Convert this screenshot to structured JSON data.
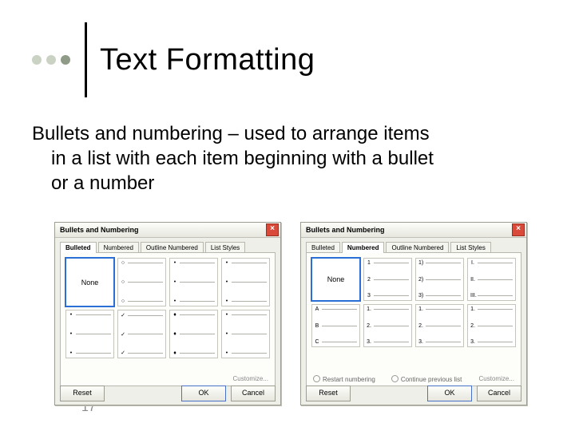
{
  "slide": {
    "title": "Text Formatting",
    "body_line1": "Bullets and numbering – used to arrange items",
    "body_line2": "in a list with each item beginning with a bullet",
    "body_line3": "or a number",
    "page_number": "17"
  },
  "dialog_shared": {
    "title": "Bullets and Numbering",
    "tabs": {
      "bulleted": "Bulleted",
      "numbered": "Numbered",
      "outline": "Outline Numbered",
      "list_styles": "List Styles"
    },
    "none_tile": "None",
    "customize": "Customize...",
    "reset": "Reset",
    "ok": "OK",
    "cancel": "Cancel"
  },
  "bulleted_dialog": {
    "active_tab": "Bulleted",
    "tiles": [
      {
        "type": "none"
      },
      {
        "marks": [
          "○",
          "○",
          "○"
        ]
      },
      {
        "marks": [
          "•",
          "•",
          "•"
        ]
      },
      {
        "marks": [
          "•",
          "•",
          "•"
        ]
      },
      {
        "marks": [
          "•",
          "•",
          "•"
        ]
      },
      {
        "marks": [
          "✓",
          "✓",
          "✓"
        ]
      },
      {
        "marks": [
          "♦",
          "♦",
          "♦"
        ]
      },
      {
        "marks": [
          "•",
          "•",
          "•"
        ]
      }
    ]
  },
  "numbered_dialog": {
    "active_tab": "Numbered",
    "radios": {
      "restart": "Restart numbering",
      "continue": "Continue previous list"
    },
    "tiles": [
      {
        "type": "none"
      },
      {
        "marks": [
          "1",
          "2",
          "3"
        ]
      },
      {
        "marks": [
          "1)",
          "2)",
          "3)"
        ]
      },
      {
        "marks": [
          "I.",
          "II.",
          "III."
        ]
      },
      {
        "marks": [
          "A",
          "B",
          "C"
        ]
      },
      {
        "marks": [
          "1.",
          "2.",
          "3."
        ]
      },
      {
        "marks": [
          "1.",
          "2.",
          "3."
        ]
      },
      {
        "marks": [
          "1.",
          "2.",
          "3."
        ]
      }
    ]
  }
}
